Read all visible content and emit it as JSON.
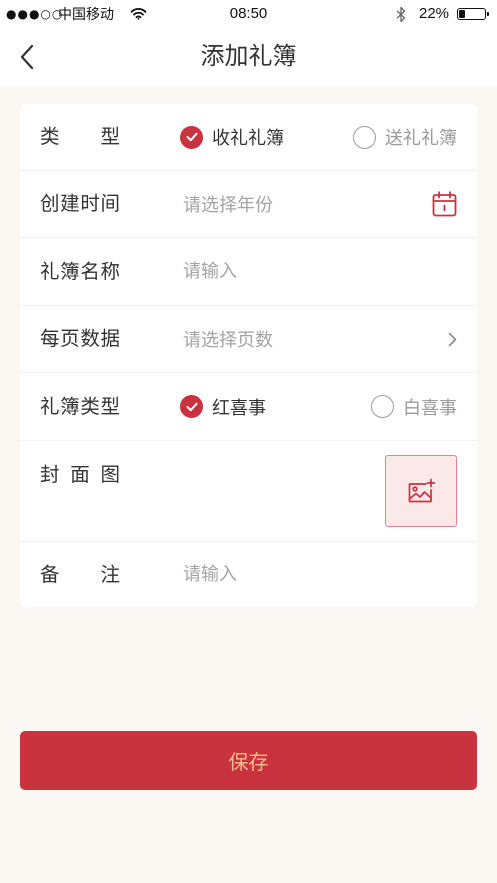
{
  "status_bar": {
    "signal": "●●●○○",
    "carrier": "中国移动",
    "time": "08:50",
    "battery_text": "22%",
    "battery_level": 0.22,
    "wifi_icon": "wifi-icon",
    "bluetooth_icon": "bluetooth-icon",
    "battery_icon": "battery-icon"
  },
  "nav": {
    "back_icon": "chevron-left-icon",
    "title": "添加礼簿"
  },
  "form": {
    "book_direction": {
      "label": "类型",
      "options": [
        {
          "label": "收礼礼簿",
          "checked": true
        },
        {
          "label": "送礼礼簿",
          "checked": false
        }
      ]
    },
    "created_time": {
      "label": "创建时间",
      "placeholder": "请选择年份",
      "icon": "calendar-icon"
    },
    "book_name": {
      "label": "礼簿名称",
      "placeholder": "请输入"
    },
    "per_page": {
      "label": "每页数据",
      "placeholder": "请选择页数",
      "icon": "chevron-right-icon"
    },
    "event_type": {
      "label": "礼簿类型",
      "options": [
        {
          "label": "红喜事",
          "checked": true
        },
        {
          "label": "白喜事",
          "checked": false
        }
      ]
    },
    "cover": {
      "label": "封面图",
      "icon": "add-image-icon"
    },
    "remark": {
      "label": "备注",
      "placeholder": "请输入"
    }
  },
  "save_button": {
    "label": "保存"
  },
  "colors": {
    "accent": "#c9323f",
    "page_background": "#fbf8f3",
    "save_text": "#f6c08c"
  }
}
